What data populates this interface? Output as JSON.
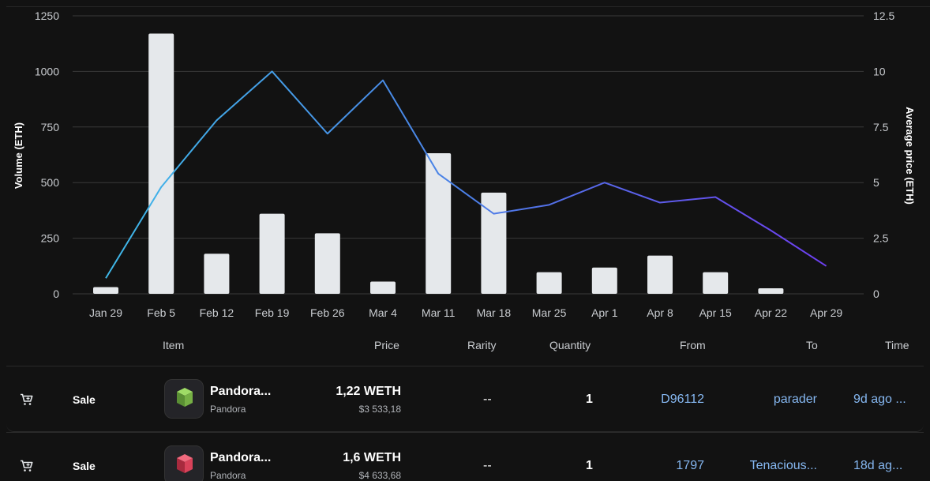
{
  "chart_data": {
    "type": "bar",
    "categories": [
      "Jan 29",
      "Feb 5",
      "Feb 12",
      "Feb 19",
      "Feb 26",
      "Mar 4",
      "Mar 11",
      "Mar 18",
      "Mar 25",
      "Apr 1",
      "Apr 8",
      "Apr 15",
      "Apr 22",
      "Apr 29"
    ],
    "series": [
      {
        "values": [
          30,
          1170,
          180,
          360,
          272,
          55,
          632,
          455,
          97,
          118,
          172,
          97,
          25,
          0
        ]
      },
      {
        "values": [
          0.7,
          4.8,
          7.8,
          10.0,
          7.2,
          9.6,
          5.4,
          3.6,
          4.0,
          5.0,
          4.1,
          4.35,
          2.85,
          1.25
        ]
      }
    ],
    "ylabel": "Volume (ETH)",
    "y2label": "Average price (ETH)",
    "ylim": [
      0,
      1250
    ],
    "y2lim": [
      0,
      12.5
    ],
    "yticks": [
      "0",
      "250",
      "500",
      "750",
      "1000",
      "1250"
    ],
    "y2ticks": [
      "0",
      "2.5",
      "5",
      "7.5",
      "10",
      "12.5"
    ],
    "grid": true,
    "colors": {
      "bar": "#e5e8eb",
      "line_start": "#3fb8e8",
      "line_mid": "#4b7fe6",
      "line_end": "#6d3ff0",
      "grid": "#3a3a3a"
    }
  },
  "table": {
    "headers": {
      "item": "Item",
      "price": "Price",
      "rarity": "Rarity",
      "quantity": "Quantity",
      "from": "From",
      "to": "To",
      "time": "Time"
    },
    "rows": [
      {
        "type": "Sale",
        "item_name": "Pandora...",
        "collection": "Pandora",
        "price": "1,22 WETH",
        "usd": "$3 533,18",
        "rarity": "--",
        "quantity": "1",
        "from": "D96112",
        "to": "parader",
        "time": "9d ago ...",
        "thumb_color": "#7fbf4a"
      },
      {
        "type": "Sale",
        "item_name": "Pandora...",
        "collection": "Pandora",
        "price": "1,6 WETH",
        "usd": "$4 633,68",
        "rarity": "--",
        "quantity": "1",
        "from": "1797",
        "to": "Tenacious...",
        "time": "18d ag...",
        "thumb_color": "#d9425a"
      }
    ]
  },
  "icons": {
    "event": "cart-icon"
  }
}
